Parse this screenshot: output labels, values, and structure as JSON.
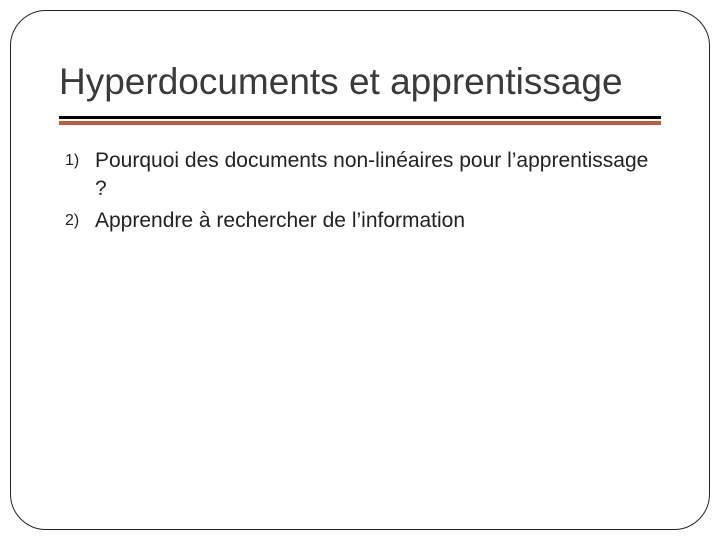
{
  "slide": {
    "title": "Hyperdocuments et apprentissage",
    "items": [
      {
        "marker": "1)",
        "text": "Pourquoi des documents non-linéaires pour l’apprentissage ?"
      },
      {
        "marker": "2)",
        "text": "Apprendre à rechercher de l’information"
      }
    ]
  }
}
